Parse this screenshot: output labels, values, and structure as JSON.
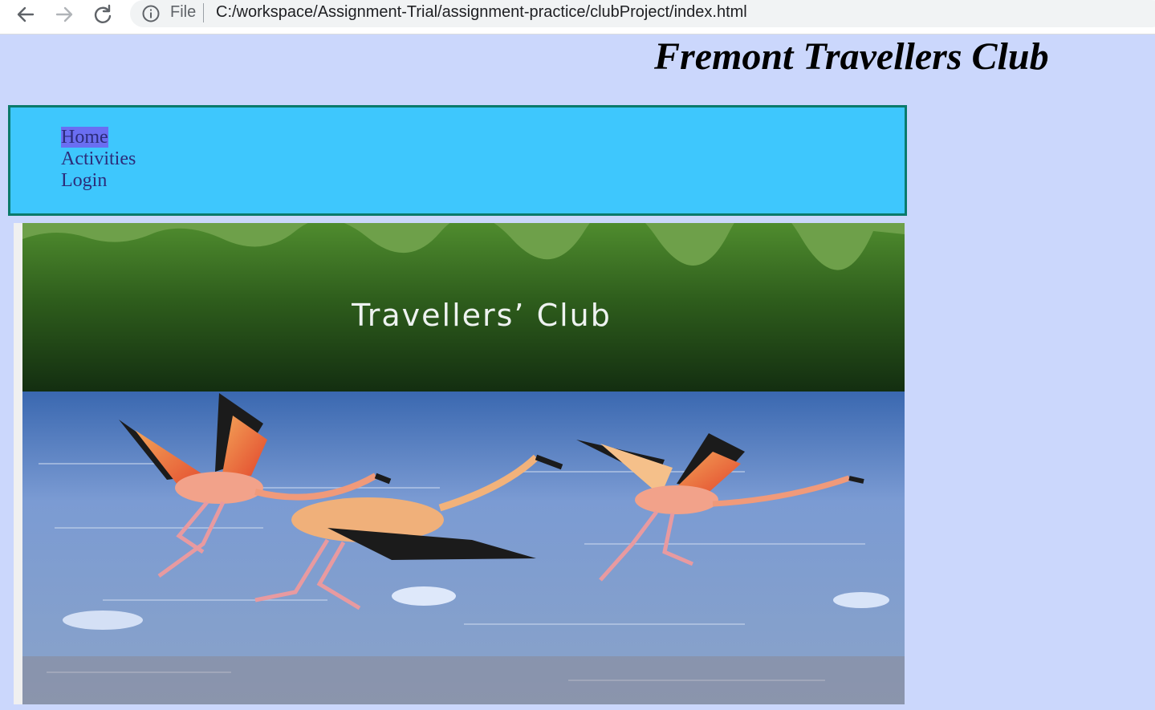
{
  "browser": {
    "scheme_label": "File",
    "url": "C:/workspace/Assignment-Trial/assignment-practice/clubProject/index.html",
    "icons": [
      "back-arrow-icon",
      "forward-arrow-icon",
      "reload-icon",
      "info-icon"
    ]
  },
  "header": {
    "title": "Fremont Travellers Club"
  },
  "nav": {
    "items": [
      {
        "label": "Home",
        "active": true
      },
      {
        "label": "Activities",
        "active": false
      },
      {
        "label": "Login",
        "active": false
      }
    ]
  },
  "hero": {
    "caption": "Travellers’ Club"
  },
  "colors": {
    "page_bg": "#cbd7fc",
    "nav_bg": "#3ec7fd",
    "nav_border": "#0b7a6b",
    "active_highlight": "#6a6ef2"
  }
}
